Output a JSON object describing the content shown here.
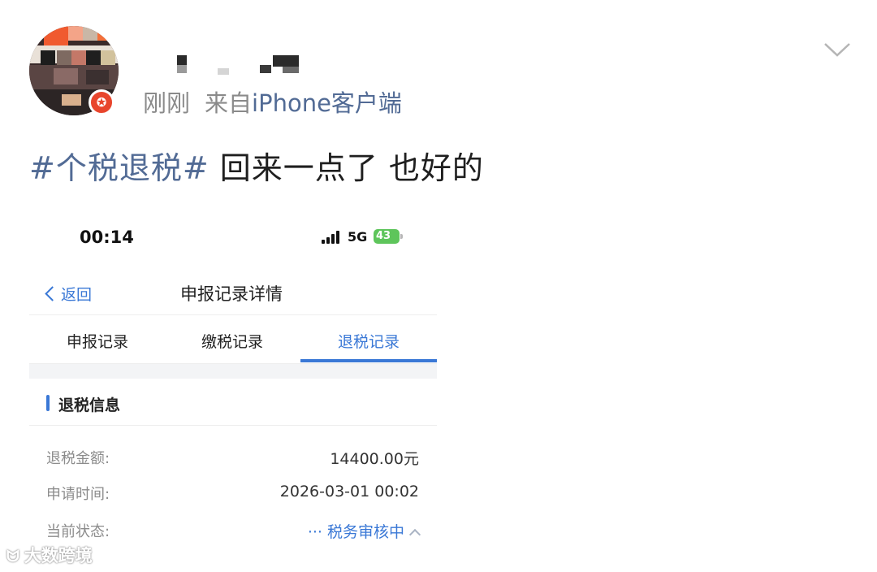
{
  "post": {
    "time": "刚刚",
    "source_prefix": "来自",
    "client": "iPhone客户端",
    "hashtag": "#个税退税#",
    "text": " 回来一点了 也好的"
  },
  "phone": {
    "status_bar": {
      "time": "00:14",
      "network": "5G",
      "battery": "43"
    },
    "navbar": {
      "back_label": "返回",
      "title": "申报记录详情"
    },
    "tabs": [
      {
        "label": "申报记录",
        "active": false
      },
      {
        "label": "缴税记录",
        "active": false
      },
      {
        "label": "退税记录",
        "active": true
      }
    ],
    "section": {
      "title": "退税信息",
      "rows": [
        {
          "label": "退税金额:",
          "value": "14400.00元"
        },
        {
          "label": "申请时间:",
          "value": "2026-03-01 00:02"
        },
        {
          "label": "当前状态:",
          "value": "··· 税务审核中"
        }
      ]
    }
  },
  "watermark": {
    "text": "大数跨境"
  },
  "colors": {
    "link_blue": "#526b95",
    "accent_blue": "#3a78d6",
    "badge_red": "#e8452c",
    "battery_green": "#5ec55b"
  },
  "icons": [
    "verified-badge-icon",
    "chevron-down-icon",
    "back-chevron-icon",
    "signal-icon",
    "battery-icon",
    "chevron-up-icon"
  ]
}
